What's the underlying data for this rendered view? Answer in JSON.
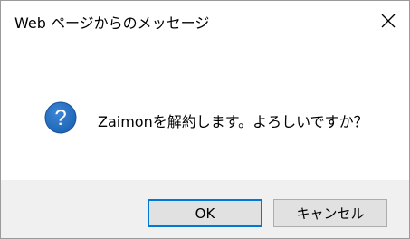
{
  "window": {
    "title": "Web ページからのメッセージ",
    "close_icon": "close-icon"
  },
  "dialog": {
    "icon": "question-icon",
    "icon_color": "#1c63b4",
    "message": "Zaimonを解約します。よろしいですか？"
  },
  "buttons": {
    "ok_label": "OK",
    "cancel_label": "キャンセル",
    "default_border_color": "#0078d7"
  }
}
